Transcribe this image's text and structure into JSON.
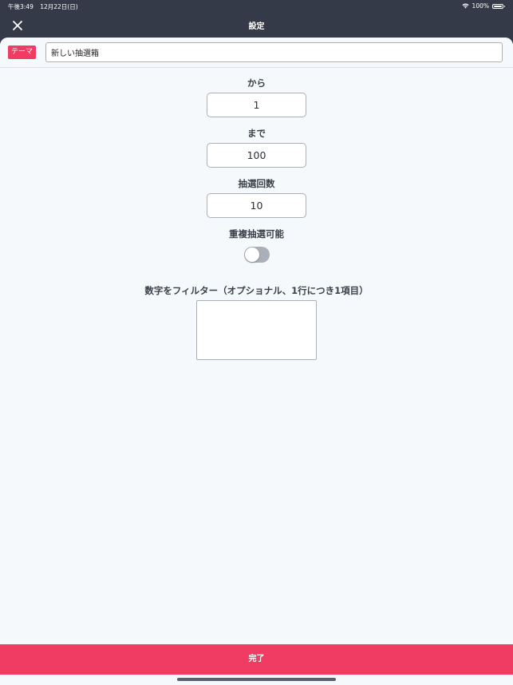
{
  "status_bar": {
    "time": "午後3:49",
    "date": "12月22日(日)",
    "battery": "100%"
  },
  "nav": {
    "title": "設定",
    "close_icon": "close-icon"
  },
  "theme": {
    "badge": "テーマ",
    "value": "新しい抽選箱"
  },
  "form": {
    "from_label": "から",
    "from_value": "1",
    "to_label": "まで",
    "to_value": "100",
    "draw_count_label": "抽選回数",
    "draw_count_value": "10",
    "duplicate_label": "重複抽選可能",
    "duplicate_enabled": false,
    "filter_label": "数字をフィルター（オプショナル、1行につき1項目）",
    "filter_value": ""
  },
  "footer": {
    "done_label": "完了"
  },
  "colors": {
    "accent": "#f03c63",
    "header_bg": "#353a48",
    "content_bg": "#f5f9fc",
    "border": "#a9b0b8"
  }
}
